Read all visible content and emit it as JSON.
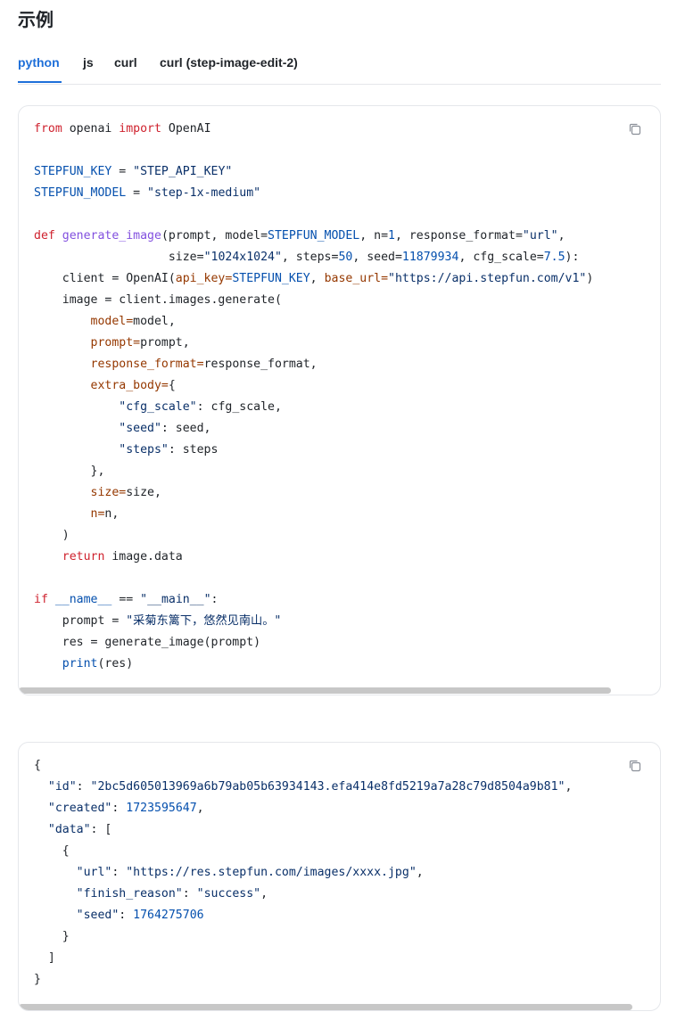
{
  "page": {
    "heading": "示例"
  },
  "tabs": [
    {
      "label": "python",
      "active": true
    },
    {
      "label": "js",
      "active": false
    },
    {
      "label": "curl",
      "active": false
    },
    {
      "label": "curl (step-image-edit-2)",
      "active": false
    }
  ],
  "request_code": {
    "language": "python",
    "copy_icon": "copy-icon",
    "lines": [
      [
        [
          "kw",
          "from"
        ],
        [
          "plain",
          " openai "
        ],
        [
          "kw",
          "import"
        ],
        [
          "plain",
          " OpenAI"
        ]
      ],
      [],
      [
        [
          "var",
          "STEPFUN_KEY"
        ],
        [
          "plain",
          " = "
        ],
        [
          "str",
          "\"STEP_API_KEY\""
        ]
      ],
      [
        [
          "var",
          "STEPFUN_MODEL"
        ],
        [
          "plain",
          " = "
        ],
        [
          "str",
          "\"step-1x-medium\""
        ]
      ],
      [],
      [
        [
          "kw",
          "def"
        ],
        [
          "plain",
          " "
        ],
        [
          "fn",
          "generate_image"
        ],
        [
          "plain",
          "(prompt, model="
        ],
        [
          "var",
          "STEPFUN_MODEL"
        ],
        [
          "plain",
          ", n="
        ],
        [
          "num",
          "1"
        ],
        [
          "plain",
          ", response_format="
        ],
        [
          "str",
          "\"url\""
        ],
        [
          "plain",
          ","
        ]
      ],
      [
        [
          "plain",
          "                   size="
        ],
        [
          "str",
          "\"1024x1024\""
        ],
        [
          "plain",
          ", steps="
        ],
        [
          "num",
          "50"
        ],
        [
          "plain",
          ", seed="
        ],
        [
          "num",
          "11879934"
        ],
        [
          "plain",
          ", cfg_scale="
        ],
        [
          "num",
          "7.5"
        ],
        [
          "plain",
          "):"
        ]
      ],
      [
        [
          "plain",
          "    client = OpenAI("
        ],
        [
          "param",
          "api_key="
        ],
        [
          "var",
          "STEPFUN_KEY"
        ],
        [
          "plain",
          ", "
        ],
        [
          "param",
          "base_url="
        ],
        [
          "str",
          "\"https://api.stepfun.com/v1\""
        ],
        [
          "plain",
          ")"
        ]
      ],
      [
        [
          "plain",
          "    image = client.images.generate("
        ]
      ],
      [
        [
          "plain",
          "        "
        ],
        [
          "param",
          "model="
        ],
        [
          "plain",
          "model,"
        ]
      ],
      [
        [
          "plain",
          "        "
        ],
        [
          "param",
          "prompt="
        ],
        [
          "plain",
          "prompt,"
        ]
      ],
      [
        [
          "plain",
          "        "
        ],
        [
          "param",
          "response_format="
        ],
        [
          "plain",
          "response_format,"
        ]
      ],
      [
        [
          "plain",
          "        "
        ],
        [
          "param",
          "extra_body="
        ],
        [
          "plain",
          "{"
        ]
      ],
      [
        [
          "plain",
          "            "
        ],
        [
          "str",
          "\"cfg_scale\""
        ],
        [
          "plain",
          ": cfg_scale,"
        ]
      ],
      [
        [
          "plain",
          "            "
        ],
        [
          "str",
          "\"seed\""
        ],
        [
          "plain",
          ": seed,"
        ]
      ],
      [
        [
          "plain",
          "            "
        ],
        [
          "str",
          "\"steps\""
        ],
        [
          "plain",
          ": steps"
        ]
      ],
      [
        [
          "plain",
          "        },"
        ]
      ],
      [
        [
          "plain",
          "        "
        ],
        [
          "param",
          "size="
        ],
        [
          "plain",
          "size,"
        ]
      ],
      [
        [
          "plain",
          "        "
        ],
        [
          "param",
          "n="
        ],
        [
          "plain",
          "n,"
        ]
      ],
      [
        [
          "plain",
          "    )"
        ]
      ],
      [
        [
          "plain",
          "    "
        ],
        [
          "kw",
          "return"
        ],
        [
          "plain",
          " image.data"
        ]
      ],
      [],
      [
        [
          "kw",
          "if"
        ],
        [
          "plain",
          " "
        ],
        [
          "var",
          "__name__"
        ],
        [
          "plain",
          " == "
        ],
        [
          "str",
          "\"__main__\""
        ],
        [
          "plain",
          ":"
        ]
      ],
      [
        [
          "plain",
          "    prompt = "
        ],
        [
          "str",
          "\"采菊东篱下，悠然见南山。\""
        ]
      ],
      [
        [
          "plain",
          "    res = generate_image(prompt)"
        ]
      ],
      [
        [
          "plain",
          "    "
        ],
        [
          "var",
          "print"
        ],
        [
          "plain",
          "(res)"
        ]
      ]
    ]
  },
  "response_code": {
    "language": "json",
    "copy_icon": "copy-icon",
    "lines": [
      [
        [
          "plain",
          "{"
        ]
      ],
      [
        [
          "plain",
          "  "
        ],
        [
          "key",
          "\"id\""
        ],
        [
          "plain",
          ": "
        ],
        [
          "str",
          "\"2bc5d605013969a6b79ab05b63934143.efa414e8fd5219a7a28c79d8504a9b81\""
        ],
        [
          "plain",
          ","
        ]
      ],
      [
        [
          "plain",
          "  "
        ],
        [
          "key",
          "\"created\""
        ],
        [
          "plain",
          ": "
        ],
        [
          "num",
          "1723595647"
        ],
        [
          "plain",
          ","
        ]
      ],
      [
        [
          "plain",
          "  "
        ],
        [
          "key",
          "\"data\""
        ],
        [
          "plain",
          ": ["
        ]
      ],
      [
        [
          "plain",
          "    {"
        ]
      ],
      [
        [
          "plain",
          "      "
        ],
        [
          "key",
          "\"url\""
        ],
        [
          "plain",
          ": "
        ],
        [
          "str",
          "\"https://res.stepfun.com/images/xxxx.jpg\""
        ],
        [
          "plain",
          ","
        ]
      ],
      [
        [
          "plain",
          "      "
        ],
        [
          "key",
          "\"finish_reason\""
        ],
        [
          "plain",
          ": "
        ],
        [
          "str",
          "\"success\""
        ],
        [
          "plain",
          ","
        ]
      ],
      [
        [
          "plain",
          "      "
        ],
        [
          "key",
          "\"seed\""
        ],
        [
          "plain",
          ": "
        ],
        [
          "num",
          "1764275706"
        ]
      ],
      [
        [
          "plain",
          "    }"
        ]
      ],
      [
        [
          "plain",
          "  ]"
        ]
      ],
      [
        [
          "plain",
          "}"
        ]
      ]
    ]
  },
  "colors": {
    "accent": "#1e6fd9",
    "keyword": "#cf222e",
    "function": "#8250df",
    "string": "#0a3069",
    "variable": "#0550ae",
    "parameter": "#953800"
  }
}
